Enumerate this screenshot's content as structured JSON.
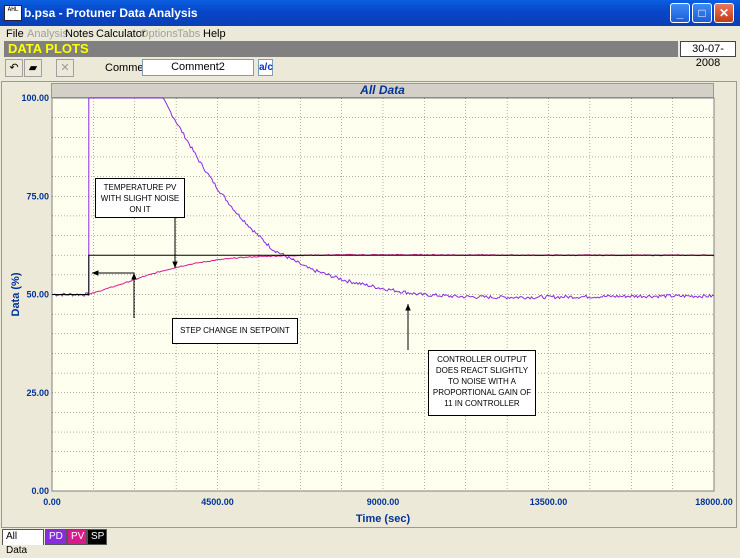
{
  "window": {
    "title": "b.psa - Protuner Data  Analysis",
    "app_icon_text": "AHL"
  },
  "menu": [
    {
      "label": "File",
      "enabled": true
    },
    {
      "label": "Analysis",
      "enabled": false
    },
    {
      "label": "Notes",
      "enabled": true
    },
    {
      "label": "Calculator",
      "enabled": true
    },
    {
      "label": "Options",
      "enabled": false
    },
    {
      "label": "Tabs",
      "enabled": false
    },
    {
      "label": "Help",
      "enabled": true
    }
  ],
  "header": {
    "title": "DATA PLOTS",
    "date": "30-07-2008"
  },
  "toolbar": {
    "comment_label": "Comment",
    "comment_value": "Comment2",
    "spell_icon": "abc-icon"
  },
  "chart_data": {
    "type": "line",
    "title": "All Data",
    "xlabel": "Time (sec)",
    "ylabel": "Data (%)",
    "xlim": [
      0,
      18000
    ],
    "ylim": [
      0,
      100
    ],
    "x_ticks": [
      "0.00",
      "4500.00",
      "9000.00",
      "13500.00",
      "18000.00"
    ],
    "y_ticks": [
      "0.00",
      "25.00",
      "50.00",
      "75.00",
      "100.00"
    ],
    "grid": true,
    "series": [
      {
        "name": "PD",
        "color": "#8a2be2",
        "x": [
          0,
          1000,
          1000,
          2200,
          3000,
          3500,
          4000,
          4500,
          5000,
          5500,
          6000,
          7000,
          8000,
          9000,
          10000,
          11000,
          12000,
          13000,
          14000,
          15000,
          16000,
          17000,
          18000
        ],
        "y": [
          50,
          50,
          100,
          100,
          100,
          92,
          84,
          77,
          71,
          66,
          61.5,
          56.5,
          53.5,
          51.5,
          50,
          49.5,
          49.3,
          49.3,
          49.4,
          49.5,
          49.6,
          49.6,
          49.6
        ]
      },
      {
        "name": "PV",
        "color": "#d81b8c",
        "x": [
          0,
          1000,
          1500,
          2000,
          2500,
          3000,
          3500,
          4000,
          4500,
          5000,
          5500,
          6000,
          7000,
          8000,
          10000,
          13000,
          18000
        ],
        "y": [
          50,
          50,
          51.5,
          53,
          54.6,
          56,
          57.2,
          58.1,
          58.8,
          59.3,
          59.6,
          59.8,
          60,
          60.1,
          60.1,
          60,
          60
        ]
      },
      {
        "name": "SP",
        "color": "#000000",
        "x": [
          0,
          1000,
          1000,
          18000
        ],
        "y": [
          50,
          50,
          60,
          60
        ]
      }
    ],
    "annotations": [
      "TEMPERATURE PV WITH SLIGHT NOISE ON IT",
      "STEP CHANGE IN SETPOINT",
      "CONTROLLER OUTPUT DOES REACT SLIGHTLY TO NOISE WITH A PROPORTIONAL GAIN OF 11 IN CONTROLLER"
    ]
  },
  "tabs": [
    "All Data",
    "PD",
    "PV",
    "SP"
  ]
}
